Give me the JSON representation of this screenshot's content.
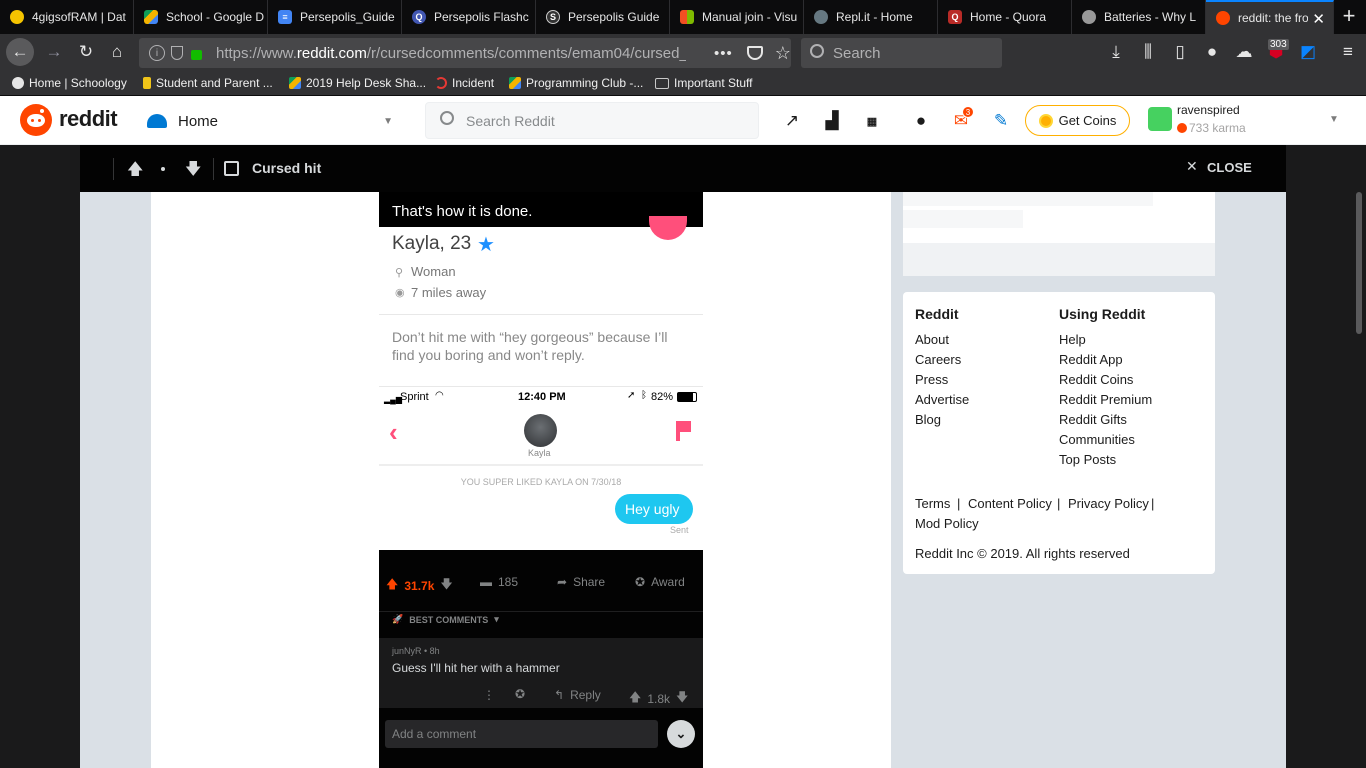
{
  "browser": {
    "tabs": [
      {
        "title": "4gigsofRAM | Dat",
        "icon": "penguin-icon",
        "color": "#f5c400"
      },
      {
        "title": "School - Google D",
        "icon": "google-drive-icon",
        "color": "#0f9d58"
      },
      {
        "title": "Persepolis_Guide",
        "icon": "google-docs-icon",
        "color": "#4285f4"
      },
      {
        "title": "Persepolis Flashc",
        "icon": "quizlet-icon",
        "color": "#4257b2"
      },
      {
        "title": "Persepolis Guide",
        "icon": "sparknotes-icon",
        "color": "#555555"
      },
      {
        "title": "Manual join - Visu",
        "icon": "microsoft-icon",
        "color": "#f25022"
      },
      {
        "title": "Repl.it - Home",
        "icon": "replit-icon",
        "color": "#667881"
      },
      {
        "title": "Home - Quora",
        "icon": "quora-icon",
        "color": "#b92b27"
      },
      {
        "title": "Batteries - Why L",
        "icon": "apple-icon",
        "color": "#999999"
      },
      {
        "title": "reddit: the fron",
        "icon": "reddit-icon",
        "color": "#ff4500"
      }
    ],
    "url_prefix": "https://www.",
    "url_host": "reddit.com",
    "url_path": "/r/cursedcomments/comments/emam04/cursed_",
    "search_placeholder": "Search",
    "badge_count": "303",
    "bookmarks": [
      {
        "label": "Home | Schoology",
        "color": "#e6e6e6"
      },
      {
        "label": "Student and Parent ...",
        "color": "#f0c419"
      },
      {
        "label": "2019 Help Desk Sha...",
        "color": "#f4b400"
      },
      {
        "label": "Incident",
        "color": "#e53935"
      },
      {
        "label": "Programming Club -...",
        "color": "#f4b400"
      },
      {
        "label": "Important Stuff",
        "color": "#c8c8c8"
      }
    ]
  },
  "reddit": {
    "logo_text": "reddit",
    "home_label": "Home",
    "search_placeholder": "Search Reddit",
    "mail_badge": "3",
    "get_coins": "Get Coins",
    "username": "ravenspired",
    "karma": "733 karma"
  },
  "overlay": {
    "post_title": "Cursed hit",
    "close_label": "CLOSE"
  },
  "post_image": {
    "caption": "That's how it is done.",
    "name_age": "Kayla, 23",
    "gender": "Woman",
    "distance": "7 miles away",
    "bio": "Don’t hit me with “hey gorgeous” because I’ll find you boring and won’t reply.",
    "carrier": "Sprint",
    "time": "12:40 PM",
    "battery": "82%",
    "contact_name": "Kayla",
    "superlike_note": "YOU SUPER LIKED KAYLA ON 7/30/18",
    "message": "Hey ugly",
    "sent": "Sent",
    "upvotes": "31.7k",
    "comments": "185",
    "share": "Share",
    "award": "Award",
    "sort_label": "BEST COMMENTS",
    "comment_author": "junNyR • 8h",
    "comment_text": "Guess I'll hit her with a hammer",
    "comment_reply": "Reply",
    "comment_votes": "1.8k",
    "add_comment": "Add a comment"
  },
  "footer": {
    "col1_title": "Reddit",
    "col1": [
      "About",
      "Careers",
      "Press",
      "Advertise",
      "Blog"
    ],
    "col2_title": "Using Reddit",
    "col2": [
      "Help",
      "Reddit App",
      "Reddit Coins",
      "Reddit Premium",
      "Reddit Gifts",
      "Communities",
      "Top Posts"
    ],
    "legal": [
      "Terms",
      "Content Policy",
      "Privacy Policy",
      "Mod Policy"
    ],
    "copyright": "Reddit Inc © 2019. All rights reserved"
  }
}
